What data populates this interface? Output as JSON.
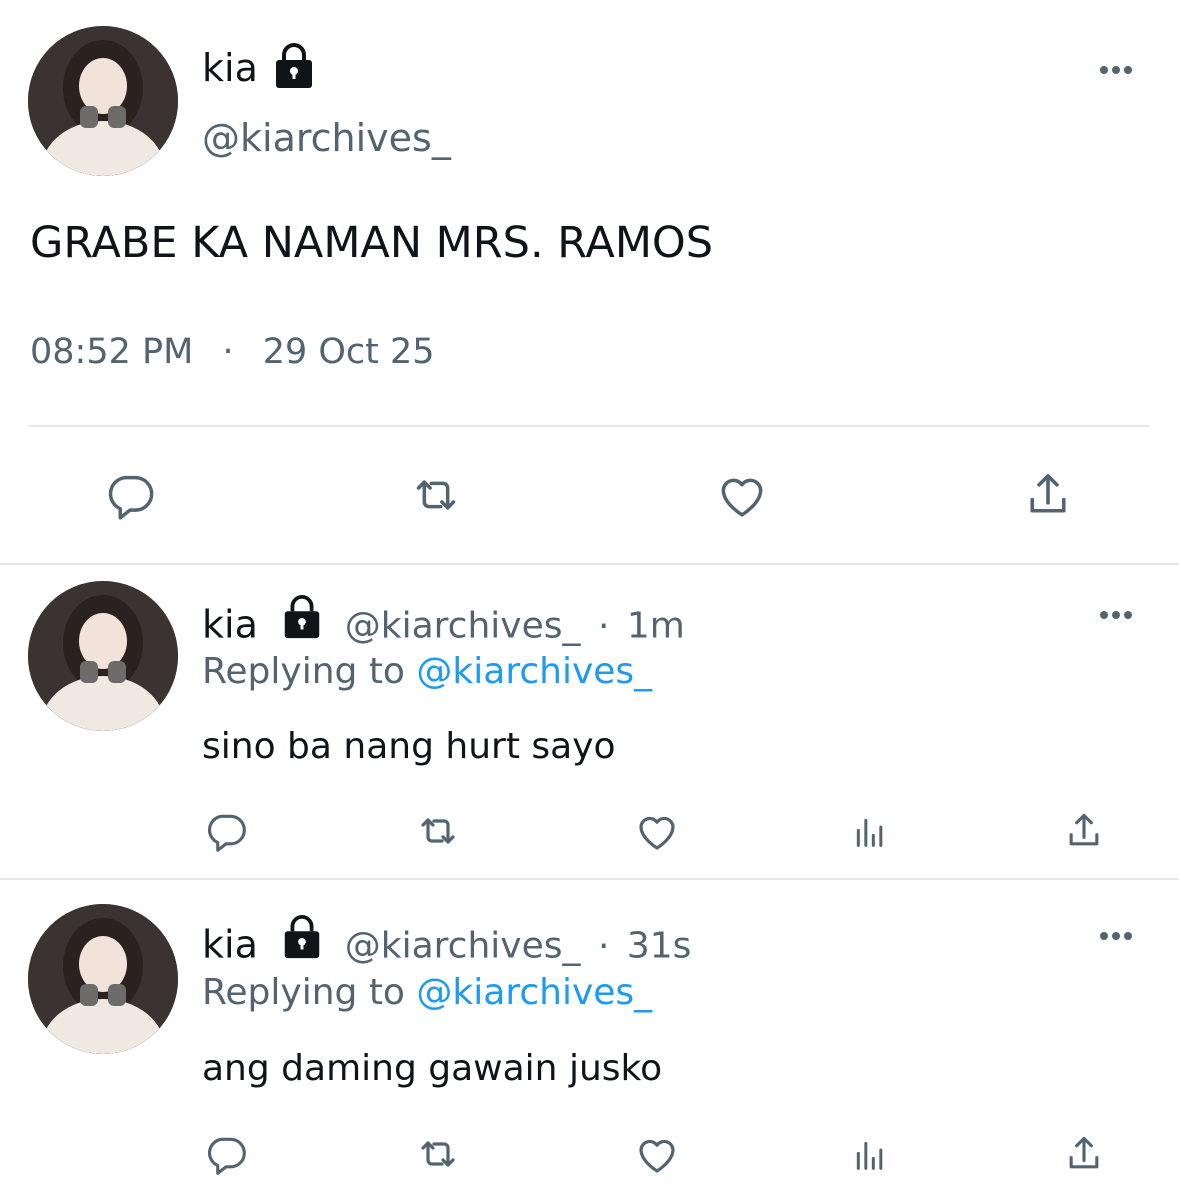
{
  "main_tweet": {
    "name": "kia",
    "handle": "@kiarchives_",
    "text": "GRABE KA NAMAN MRS. RAMOS",
    "time": "08:52 PM",
    "separator": "·",
    "date": "29 Oct 25"
  },
  "replies": [
    {
      "name": "kia",
      "handle": "@kiarchives_",
      "dot": "·",
      "age": "1m",
      "replying_label": "Replying to",
      "replying_handle": "@kiarchives_",
      "text": "sino ba nang hurt sayo"
    },
    {
      "name": "kia",
      "handle": "@kiarchives_",
      "dot": "·",
      "age": "31s",
      "replying_label": "Replying to",
      "replying_handle": "@kiarchives_",
      "text": "ang daming gawain jusko"
    }
  ],
  "icons": {
    "more": "more-horizontal-icon",
    "lock": "lock-icon",
    "reply": "reply-icon",
    "retweet": "retweet-icon",
    "like": "heart-icon",
    "views": "views-icon",
    "share": "share-icon"
  },
  "colors": {
    "text": "#0f1419",
    "secondary": "#536471",
    "link": "#1d9bf0",
    "divider": "#e6e9ec"
  }
}
